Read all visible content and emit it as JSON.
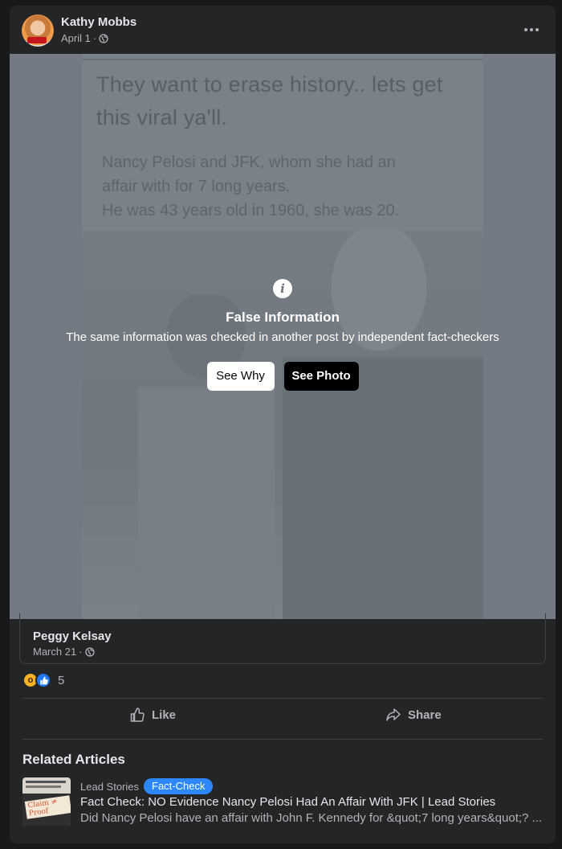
{
  "post": {
    "author": "Kathy Mobbs",
    "date": "April 1",
    "separator": " · ",
    "privacy_icon": "globe-icon",
    "menu_icon": "more-options-icon"
  },
  "media": {
    "headline": "They want to erase history..  lets get this viral ya'll.",
    "caption_lines": [
      "Nancy Pelosi and JFK, whom she had an",
      "affair with for 7 long years.",
      "He was 43 years old in 1960, she was 20."
    ]
  },
  "warning": {
    "icon": "info-icon",
    "title": "False Information",
    "description": "The same information was checked in another post by independent fact-checkers",
    "see_why": "See Why",
    "see_photo": "See Photo"
  },
  "shared_from": {
    "name": "Peggy Kelsay",
    "date": "March 21",
    "separator": " · "
  },
  "reactions": {
    "types": [
      "wow",
      "like"
    ],
    "count": "5"
  },
  "actions": {
    "like": "Like",
    "share": "Share"
  },
  "related": {
    "heading": "Related Articles",
    "source": "Lead Stories",
    "badge": "Fact-Check",
    "title": "Fact Check: NO Evidence Nancy Pelosi Had An Affair With JFK | Lead Stories",
    "description": "Did Nancy Pelosi have an affair with John F. Kennedy for &quot;7 long years&quot;? ...",
    "thumb_stamp": "Claim ≠ Proof"
  },
  "colors": {
    "card_bg": "#242526",
    "page_bg": "#18191a",
    "primary_text": "#e4e6eb",
    "secondary_text": "#b0b3b8",
    "badge_blue": "#2d88ff"
  }
}
